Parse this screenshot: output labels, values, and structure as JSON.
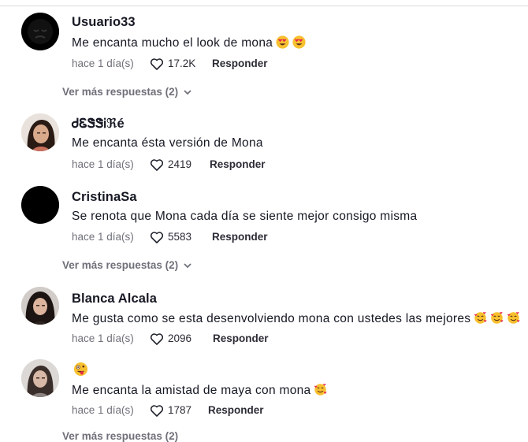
{
  "comments": [
    {
      "user": "Usuario33",
      "text": "Me encanta mucho el look de mona",
      "emojis": [
        "heart-eyes",
        "heart-eyes"
      ],
      "time": "hace 1 día(s)",
      "likes": "17.2K",
      "reply": "Responder",
      "more": "Ver más respuestas (2)"
    },
    {
      "user": "ᏧᏋᏕᏕᎥℜé",
      "text": "Me encanta ésta versión de Mona",
      "emojis": [],
      "time": "hace 1 día(s)",
      "likes": "2419",
      "reply": "Responder"
    },
    {
      "user": "CristinaSa",
      "text": "Se renota que Mona cada día se siente mejor consigo misma",
      "emojis": [],
      "time": "hace 1 día(s)",
      "likes": "5583",
      "reply": "Responder",
      "more": "Ver más respuestas (2)"
    },
    {
      "user": "Blanca Alcala",
      "text": "Me gusta como se esta desenvolviendo mona con ustedes las mejores",
      "emojis": [
        "smiling-hearts",
        "smiling-hearts",
        "smiling-hearts"
      ],
      "time": "hace 1 día(s)",
      "likes": "2096",
      "reply": "Responder"
    },
    {
      "user": "",
      "text": "Me encanta la amistad de maya con mona",
      "emojis": [
        "smiling-hearts"
      ],
      "username_emoji": "zany-face",
      "time": "hace 1 día(s)",
      "likes": "1787",
      "reply": "Responder",
      "more": "Ver más respuestas (2)"
    }
  ],
  "colors": {
    "text": "#161823",
    "muted": "#6f7079",
    "emoji_face": "#f7c02f",
    "heart_red": "#e7274a"
  }
}
